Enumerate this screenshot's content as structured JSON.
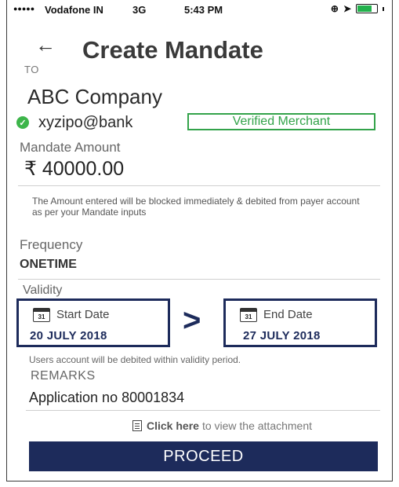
{
  "status_bar": {
    "signal": "●●●●●",
    "carrier": "Vodafone IN",
    "network": "3G",
    "time": "5:43 PM"
  },
  "header": {
    "back_icon": "left-arrow-icon",
    "title": "Create Mandate"
  },
  "payee": {
    "to_label": "TO",
    "name": "ABC Company",
    "upi_id": "xyzipo@bank",
    "verified_label": "Verified Merchant"
  },
  "amount": {
    "label": "Mandate Amount",
    "value": "₹ 40000.00",
    "note": "The Amount entered will be blocked immediately & debited from payer account as per your Mandate inputs"
  },
  "frequency": {
    "label": "Frequency",
    "value": "ONETIME"
  },
  "validity": {
    "label": "Validity",
    "start_caption": "Start Date",
    "start_value": "20 JULY 2018",
    "end_caption": "End Date",
    "end_value": "27 JULY 2018",
    "calendar_day": "31",
    "separator": ">",
    "note": "Users account will be debited within validity period."
  },
  "remarks": {
    "label": "REMARKS",
    "value": "Application no 80001834"
  },
  "attachment": {
    "link_text": "Click here",
    "rest_text": "to view the attachment"
  },
  "actions": {
    "proceed_label": "PROCEED"
  },
  "colors": {
    "primary": "#1d2b5b",
    "verified_green": "#33a34a"
  }
}
